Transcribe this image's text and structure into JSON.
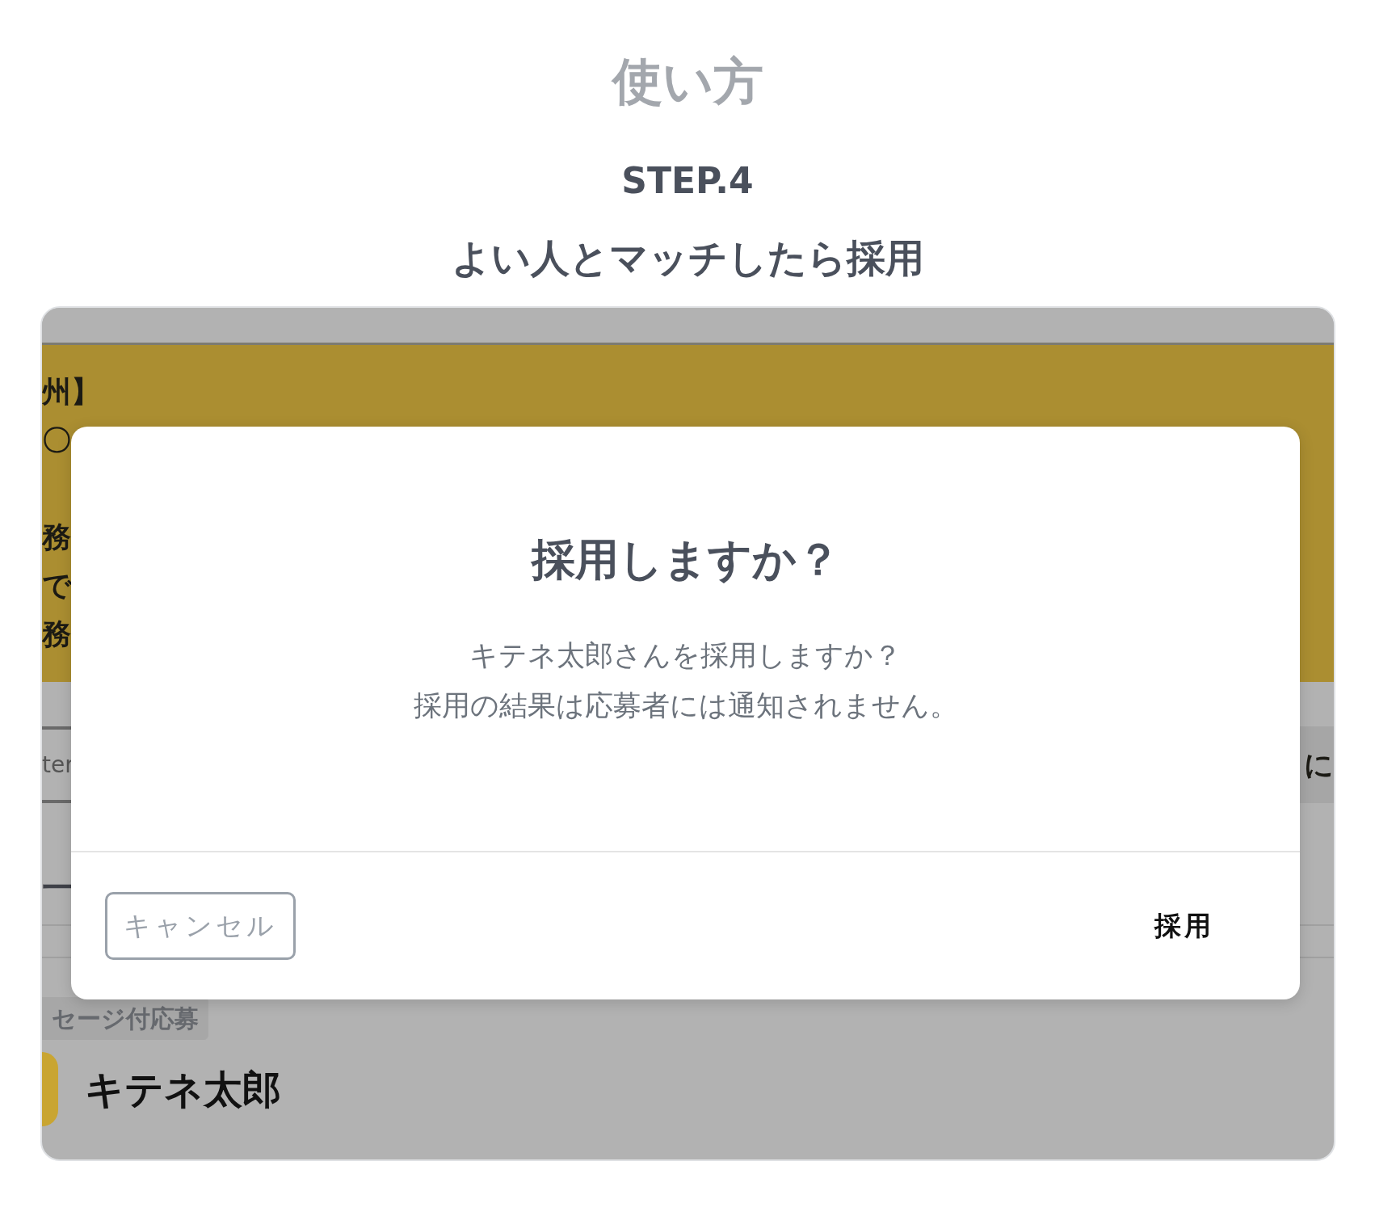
{
  "page": {
    "title": "使い方",
    "step": "STEP.4",
    "heading": "よい人とマッチしたら採用"
  },
  "screen": {
    "banner_lines": [
      "州】",
      "〇",
      "務",
      "で",
      "務"
    ],
    "field_text": "ter",
    "right_text": "に",
    "section_title": "一",
    "tag": "セージ付応募",
    "applicant_name": "キテネ太郎"
  },
  "dialog": {
    "title": "採用しますか？",
    "message_lines": [
      "キテネ太郎さんを採用しますか？",
      "採用の結果は応募者には通知されません。"
    ],
    "buttons": [
      {
        "label": "キャンセル",
        "kind": "outline"
      },
      {
        "label": "採用",
        "kind": "text"
      }
    ]
  }
}
